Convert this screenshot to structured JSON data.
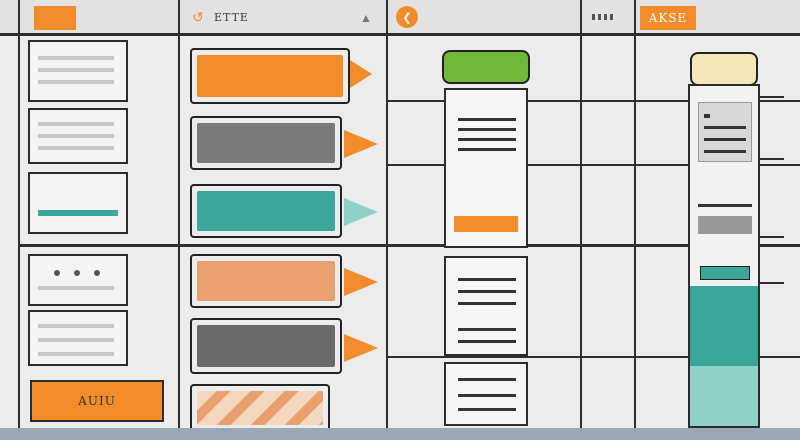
{
  "header": {
    "center_label": "ETTE",
    "right_label": "AKSE",
    "icon_center": "undo-icon",
    "icon_right": "chevron-icon"
  },
  "left_panel": {
    "button_label": "AUIU"
  },
  "colors": {
    "orange": "#f28c2b",
    "gray": "#7a7a7a",
    "teal": "#3aa79a",
    "peach": "#e9a06e",
    "green": "#6fb83a",
    "cream": "#f3e6b8",
    "light_teal": "#8fd1c7"
  }
}
